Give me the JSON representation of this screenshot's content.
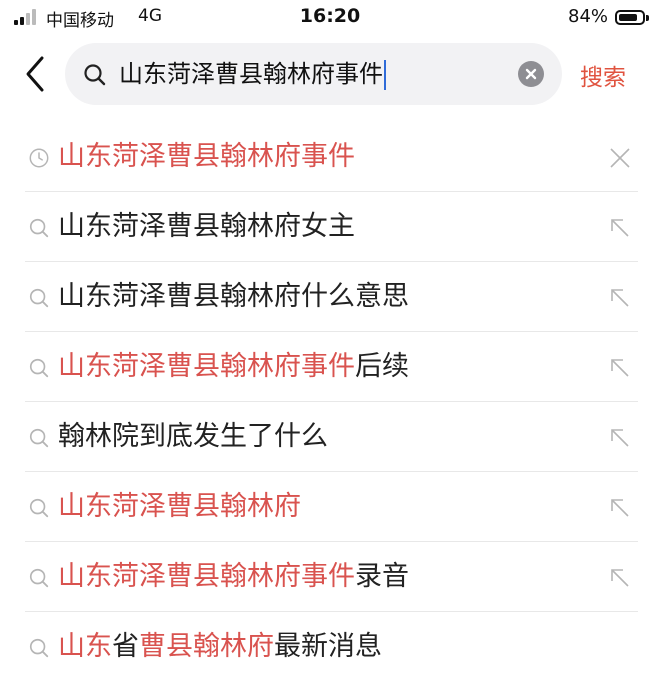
{
  "status_bar": {
    "carrier": "中国移动",
    "network": "4G",
    "time": "16:20",
    "battery": "84%",
    "battery_level": 0.84
  },
  "search": {
    "back_icon": "chevron-left-icon",
    "search_icon": "search-icon",
    "query": "山东菏泽曹县翰林府事件",
    "clear_icon": "clear-circle-icon",
    "submit_label": "搜索"
  },
  "colors": {
    "accent": "#e0533f",
    "highlight": "#d9534f",
    "text": "#222222",
    "search_bg": "#f2f2f4"
  },
  "suggestions": [
    {
      "type": "history",
      "icon": "clock-icon",
      "action_icon": "close-icon",
      "segments": [
        {
          "text": "山东菏泽曹县翰林府事件",
          "highlight": true
        }
      ]
    },
    {
      "type": "suggestion",
      "icon": "search-icon",
      "action_icon": "arrow-up-left-icon",
      "segments": [
        {
          "text": "山东菏泽曹县翰林府女主",
          "highlight": false
        }
      ]
    },
    {
      "type": "suggestion",
      "icon": "search-icon",
      "action_icon": "arrow-up-left-icon",
      "segments": [
        {
          "text": "山东菏泽曹县翰林府什么意思",
          "highlight": false
        }
      ]
    },
    {
      "type": "suggestion",
      "icon": "search-icon",
      "action_icon": "arrow-up-left-icon",
      "segments": [
        {
          "text": "山东菏泽曹县翰林府事件",
          "highlight": true
        },
        {
          "text": "后续",
          "highlight": false
        }
      ]
    },
    {
      "type": "suggestion",
      "icon": "search-icon",
      "action_icon": "arrow-up-left-icon",
      "segments": [
        {
          "text": "翰林院到底发生了什么",
          "highlight": false
        }
      ]
    },
    {
      "type": "suggestion",
      "icon": "search-icon",
      "action_icon": "arrow-up-left-icon",
      "segments": [
        {
          "text": "山东菏泽曹县翰林府",
          "highlight": true
        }
      ]
    },
    {
      "type": "suggestion",
      "icon": "search-icon",
      "action_icon": "arrow-up-left-icon",
      "segments": [
        {
          "text": "山东菏泽曹县翰林府事件",
          "highlight": true
        },
        {
          "text": "录音",
          "highlight": false
        }
      ]
    },
    {
      "type": "suggestion",
      "icon": "search-icon",
      "action_icon": null,
      "segments": [
        {
          "text": "山东",
          "highlight": true
        },
        {
          "text": "省",
          "highlight": false
        },
        {
          "text": "曹县翰林府",
          "highlight": true
        },
        {
          "text": "最新消息",
          "highlight": false
        }
      ]
    }
  ]
}
